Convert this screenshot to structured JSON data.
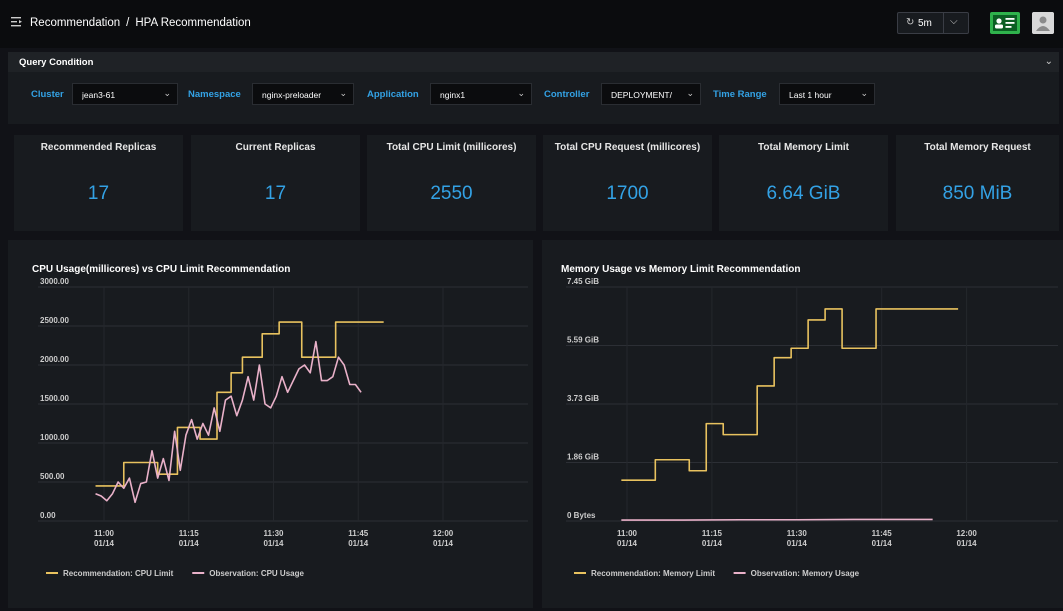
{
  "header": {
    "breadcrumb_parent": "Recommendation",
    "breadcrumb_separator": "/",
    "breadcrumb_current": "HPA Recommendation",
    "refresh_interval": "5m",
    "icons": [
      "menu-icon",
      "refresh-icon",
      "chevron-down-icon",
      "id-card-icon",
      "avatar"
    ]
  },
  "query": {
    "title": "Query Condition",
    "filters": [
      {
        "label": "Cluster",
        "value": "jean3-61"
      },
      {
        "label": "Namespace",
        "value": "nginx-preloader"
      },
      {
        "label": "Application",
        "value": "nginx1"
      },
      {
        "label": "Controller",
        "value": "DEPLOYMENT/"
      },
      {
        "label": "Time Range",
        "value": "Last 1 hour"
      }
    ]
  },
  "stats": [
    {
      "title": "Recommended Replicas",
      "value": "17"
    },
    {
      "title": "Current Replicas",
      "value": "17"
    },
    {
      "title": "Total CPU Limit (millicores)",
      "value": "2550"
    },
    {
      "title": "Total CPU Request (millicores)",
      "value": "1700"
    },
    {
      "title": "Total Memory Limit",
      "value": "6.64 GiB"
    },
    {
      "title": "Total Memory Request",
      "value": "850 MiB"
    }
  ],
  "colors": {
    "accent": "#33a2e5",
    "limit_series": "#e8c25f",
    "usage_series": "#e9b1c9",
    "background": "#111217",
    "panel": "#181b1f"
  },
  "chart_data": [
    {
      "type": "line",
      "title": "CPU Usage(millicores) vs CPU Limit Recommendation",
      "y_tick_labels": [
        "3000.00",
        "2500.00",
        "2000.00",
        "1500.00",
        "1000.00",
        "500.00",
        "0.00"
      ],
      "ylim": [
        0,
        3000
      ],
      "x_tick_labels": [
        [
          "11:00",
          "01/14"
        ],
        [
          "11:15",
          "01/14"
        ],
        [
          "11:30",
          "01/14"
        ],
        [
          "11:45",
          "01/14"
        ],
        [
          "12:00",
          "01/14"
        ]
      ],
      "x_ticks_minutes": [
        0,
        15,
        30,
        45,
        60
      ],
      "grid": true,
      "legend": "bottom-left",
      "series": [
        {
          "name": "Recommendation: CPU Limit",
          "step": true,
          "x": [
            -1.5,
            3.5,
            9.5,
            13,
            17,
            20,
            22.5,
            24.5,
            28,
            31,
            35,
            41,
            49.5
          ],
          "y": [
            450,
            750,
            600,
            1200,
            1050,
            1650,
            1900,
            2100,
            2400,
            2550,
            2100,
            2550,
            2550
          ]
        },
        {
          "name": "Observation: CPU Usage",
          "step": false,
          "x": [
            -1.5,
            -0.5,
            0.5,
            1.5,
            2.5,
            3.5,
            4.5,
            5.5,
            6.5,
            7.5,
            8.5,
            9.5,
            10.5,
            11.5,
            12.5,
            13.5,
            14.5,
            15.5,
            16.5,
            17.5,
            18.5,
            19.5,
            20.5,
            21.5,
            22.5,
            23.5,
            24.5,
            25.5,
            26.5,
            27.5,
            28.5,
            29.5,
            30.5,
            31.5,
            32.5,
            33.5,
            34.5,
            35.5,
            36.5,
            37.5,
            38.5,
            39.5,
            40.5,
            41.5,
            42.5,
            43.5,
            44.5,
            45.5
          ],
          "y": [
            350,
            320,
            260,
            350,
            500,
            420,
            550,
            240,
            480,
            500,
            900,
            550,
            800,
            520,
            1150,
            650,
            1100,
            1300,
            1050,
            1250,
            1100,
            1450,
            1150,
            1550,
            1600,
            1350,
            1550,
            1850,
            1550,
            2000,
            1500,
            1450,
            1600,
            1850,
            1650,
            1800,
            1950,
            2000,
            1900,
            2300,
            1800,
            1800,
            1850,
            2100,
            2000,
            1750,
            1750,
            1650
          ]
        }
      ]
    },
    {
      "type": "line",
      "title": "Memory Usage vs Memory Limit Recommendation",
      "y_tick_labels": [
        "7.45 GiB",
        "5.59 GiB",
        "3.73 GiB",
        "1.86 GiB",
        "0 Bytes"
      ],
      "ylim": [
        0,
        7.45
      ],
      "x_tick_labels": [
        [
          "11:00",
          "01/14"
        ],
        [
          "11:15",
          "01/14"
        ],
        [
          "11:30",
          "01/14"
        ],
        [
          "11:45",
          "01/14"
        ],
        [
          "12:00",
          "01/14"
        ]
      ],
      "x_ticks_minutes": [
        0,
        15,
        30,
        45,
        60
      ],
      "grid": true,
      "legend": "bottom-left",
      "series": [
        {
          "name": "Recommendation: Memory Limit",
          "step": true,
          "x": [
            -1,
            5,
            11,
            14,
            17,
            23,
            26,
            29,
            32,
            35,
            38,
            44,
            58.5
          ],
          "y": [
            1.3,
            1.95,
            1.6,
            3.1,
            2.75,
            4.3,
            5.2,
            5.5,
            6.4,
            6.75,
            5.5,
            6.75,
            6.75
          ]
        },
        {
          "name": "Observation: Memory Usage",
          "step": false,
          "x": [
            -1,
            10,
            20,
            30,
            40,
            54
          ],
          "y": [
            0.03,
            0.03,
            0.04,
            0.04,
            0.05,
            0.05
          ]
        }
      ]
    }
  ]
}
